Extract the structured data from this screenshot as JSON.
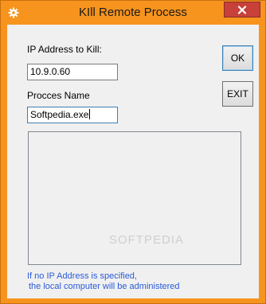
{
  "window": {
    "title": "KIll Remote Process",
    "app_icon": "gear-icon",
    "close_icon": "close-icon",
    "accent_color": "#f7941e",
    "close_color": "#c7413a"
  },
  "form": {
    "ip_label": "IP Address to Kill:",
    "ip_value": "10.9.0.60",
    "process_label": "Procces Name",
    "process_value": "Softpedia.exe"
  },
  "buttons": {
    "ok_label": "OK",
    "exit_label": "EXIT"
  },
  "note": {
    "line1": "If no IP Address is specified,",
    "line2": "the local computer will be administered",
    "color": "#2b5bd7"
  },
  "watermark": "SOFTPEDIA"
}
